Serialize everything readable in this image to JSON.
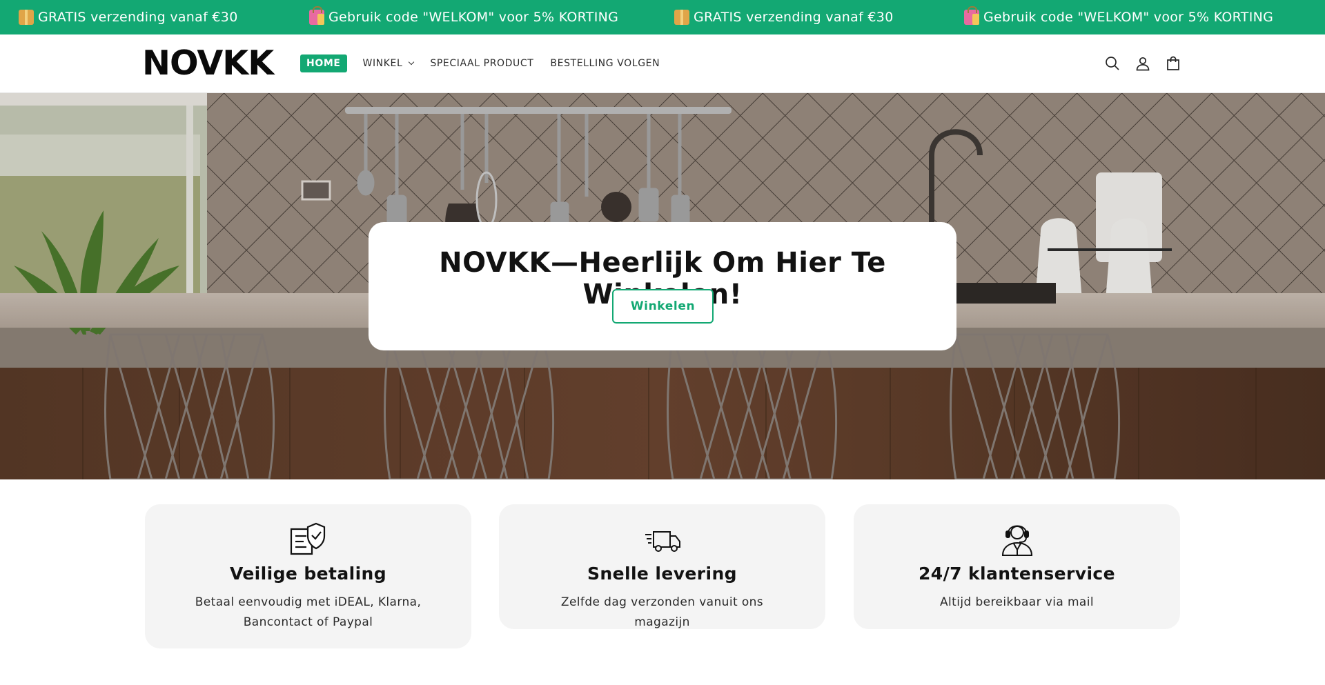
{
  "announcement": {
    "items": [
      {
        "icon": "package-icon",
        "text": "GRATIS verzending vanaf €30"
      },
      {
        "icon": "shopping-bag-icon",
        "text": "Gebruik code \"WELKOM\" voor 5% KORTING"
      },
      {
        "icon": "package-icon",
        "text": "GRATIS verzending vanaf €30"
      },
      {
        "icon": "shopping-bag-icon",
        "text": "Gebruik code \"WELKOM\" voor 5% KORTING"
      }
    ]
  },
  "header": {
    "logo": "NOVKK",
    "nav": [
      {
        "label": "HOME",
        "active": true
      },
      {
        "label": "WINKEL",
        "dropdown": true
      },
      {
        "label": "SPECIAAL PRODUCT"
      },
      {
        "label": "BESTELLING VOLGEN"
      }
    ],
    "icons": [
      "search-icon",
      "account-icon",
      "cart-icon"
    ]
  },
  "hero": {
    "title": "NOVKK—Heerlijk Om Hier Te Winkelen!",
    "button": "Winkelen"
  },
  "features": [
    {
      "icon": "secure-payment-icon",
      "title": "Veilige betaling",
      "description": "Betaal eenvoudig met iDEAL, Klarna, Bancontact of Paypal"
    },
    {
      "icon": "delivery-truck-icon",
      "title": "Snelle levering",
      "description": "Zelfde dag verzonden vanuit ons magazijn"
    },
    {
      "icon": "customer-service-icon",
      "title": "24/7 klantenservice",
      "description": "Altijd bereikbaar via mail"
    }
  ],
  "colors": {
    "brand": "#13a873",
    "card_bg": "#f4f4f4",
    "text": "#121212"
  }
}
